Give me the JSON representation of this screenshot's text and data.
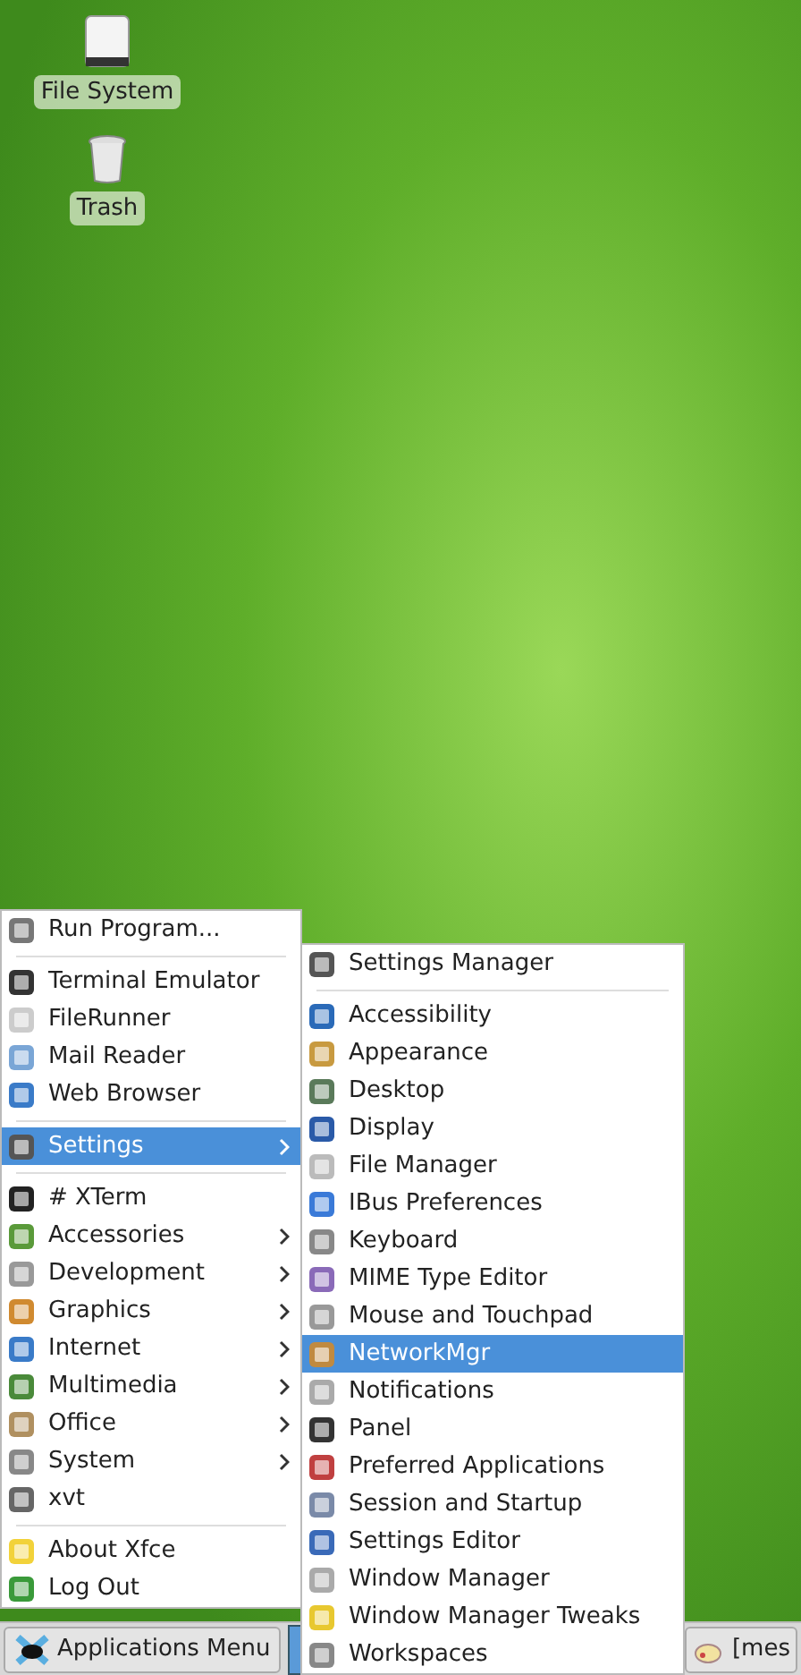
{
  "desktop_icons": [
    {
      "label": "File System",
      "kind": "drive"
    },
    {
      "label": "Trash",
      "kind": "trash"
    }
  ],
  "applications_menu": {
    "groups": [
      [
        {
          "label": "Run Program...",
          "selected": false,
          "has_submenu": false
        }
      ],
      [
        {
          "label": "Terminal Emulator",
          "selected": false,
          "has_submenu": false
        },
        {
          "label": "FileRunner",
          "selected": false,
          "has_submenu": false
        },
        {
          "label": "Mail Reader",
          "selected": false,
          "has_submenu": false
        },
        {
          "label": "Web Browser",
          "selected": false,
          "has_submenu": false
        }
      ],
      [
        {
          "label": "Settings",
          "selected": true,
          "has_submenu": true
        }
      ],
      [
        {
          "label": "# XTerm",
          "selected": false,
          "has_submenu": false
        },
        {
          "label": "Accessories",
          "selected": false,
          "has_submenu": true
        },
        {
          "label": "Development",
          "selected": false,
          "has_submenu": true
        },
        {
          "label": "Graphics",
          "selected": false,
          "has_submenu": true
        },
        {
          "label": "Internet",
          "selected": false,
          "has_submenu": true
        },
        {
          "label": "Multimedia",
          "selected": false,
          "has_submenu": true
        },
        {
          "label": "Office",
          "selected": false,
          "has_submenu": true
        },
        {
          "label": "System",
          "selected": false,
          "has_submenu": true
        },
        {
          "label": "xvt",
          "selected": false,
          "has_submenu": false
        }
      ],
      [
        {
          "label": "About Xfce",
          "selected": false,
          "has_submenu": false
        },
        {
          "label": "Log Out",
          "selected": false,
          "has_submenu": false
        }
      ]
    ]
  },
  "settings_submenu": {
    "groups": [
      [
        {
          "label": "Settings Manager",
          "selected": false
        }
      ],
      [
        {
          "label": "Accessibility",
          "selected": false
        },
        {
          "label": "Appearance",
          "selected": false
        },
        {
          "label": "Desktop",
          "selected": false
        },
        {
          "label": "Display",
          "selected": false
        },
        {
          "label": "File Manager",
          "selected": false
        },
        {
          "label": "IBus Preferences",
          "selected": false
        },
        {
          "label": "Keyboard",
          "selected": false
        },
        {
          "label": "MIME Type Editor",
          "selected": false
        },
        {
          "label": "Mouse and Touchpad",
          "selected": false
        },
        {
          "label": "NetworkMgr",
          "selected": true
        },
        {
          "label": "Notifications",
          "selected": false
        },
        {
          "label": "Panel",
          "selected": false
        },
        {
          "label": "Preferred Applications",
          "selected": false
        },
        {
          "label": "Session and Startup",
          "selected": false
        },
        {
          "label": "Settings Editor",
          "selected": false
        },
        {
          "label": "Window Manager",
          "selected": false
        },
        {
          "label": "Window Manager Tweaks",
          "selected": false
        },
        {
          "label": "Workspaces",
          "selected": false
        }
      ]
    ]
  },
  "panel": {
    "menu_button": "Applications Menu",
    "window_buttons": [
      {
        "label": "[mes"
      }
    ]
  }
}
